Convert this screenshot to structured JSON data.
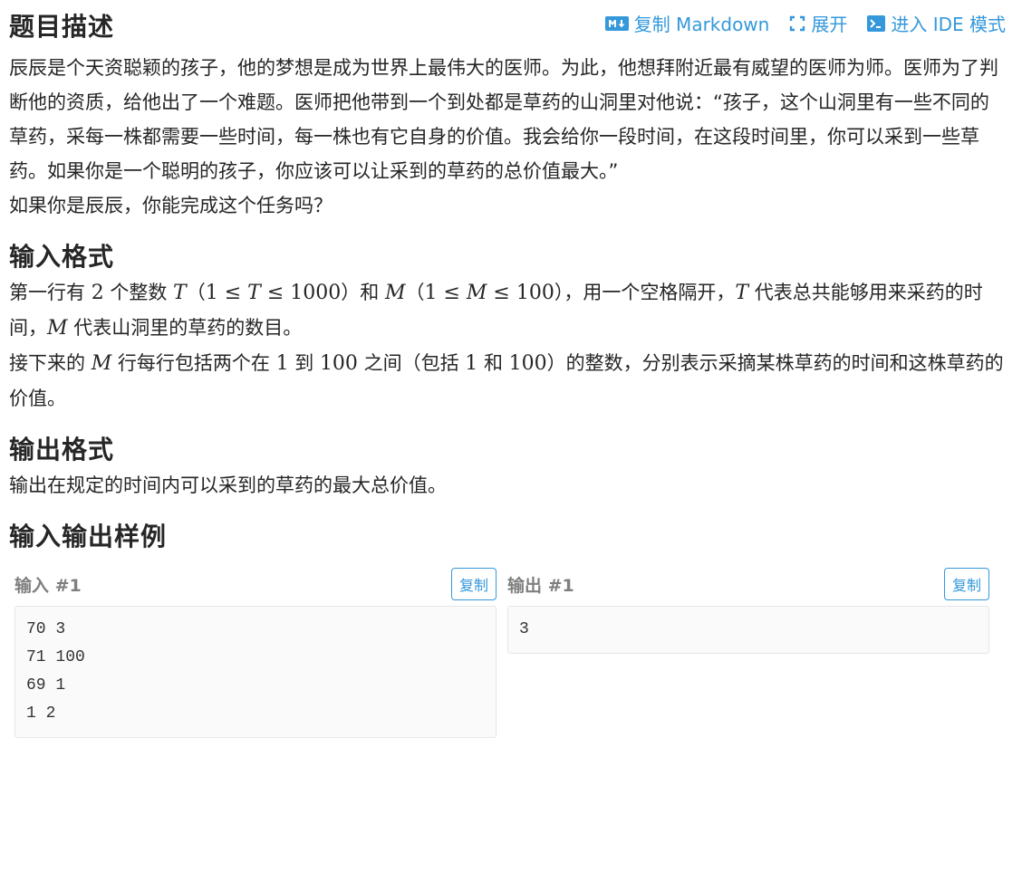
{
  "header": {
    "title": "题目描述",
    "toolbar": {
      "copy_markdown": "复制 Markdown",
      "expand": "展开",
      "ide_mode": "进入 IDE 模式"
    }
  },
  "description": {
    "paragraph1": "辰辰是个天资聪颖的孩子，他的梦想是成为世界上最伟大的医师。为此，他想拜附近最有威望的医师为师。医师为了判断他的资质，给他出了一个难题。医师把他带到一个到处都是草药的山洞里对他说：“孩子，这个山洞里有一些不同的草药，采每一株都需要一些时间，每一株也有它自身的价值。我会给你一段时间，在这段时间里，你可以采到一些草药。如果你是一个聪明的孩子，你应该可以让采到的草药的总价值最大。”",
    "paragraph2": "如果你是辰辰，你能完成这个任务吗？"
  },
  "input_format": {
    "title": "输入格式",
    "p1": {
      "t1": "第一行有 ",
      "n2": "2",
      "t2": " 个整数 ",
      "T": "T",
      "c1": "（",
      "r1": "1 ≤ ",
      "T2": "T",
      "r1b": " ≤ 1000",
      "c2": "）和 ",
      "M": "M",
      "c3": "（",
      "r2": "1 ≤ ",
      "M2": "M",
      "r2b": " ≤ 100",
      "c4": "），用一个空格隔开，",
      "T3": "T",
      "t3": " 代表总共能够用来采药的时间，",
      "M3": "M",
      "t4": " 代表山洞里的草药的数目。"
    },
    "p2": {
      "t1": "接下来的 ",
      "M": "M",
      "t2": " 行每行包括两个在 ",
      "n1": "1",
      "t3": " 到 ",
      "n2": "100",
      "t4": " 之间（包括 ",
      "n3": "1",
      "t5": " 和 ",
      "n4": "100",
      "t6": "）的整数，分别表示采摘某株草药的时间和这株草药的价值。"
    }
  },
  "output_format": {
    "title": "输出格式",
    "p1": "输出在规定的时间内可以采到的草药的最大总价值。"
  },
  "samples": {
    "title": "输入输出样例",
    "input": {
      "label": "输入 #1",
      "copy": "复制",
      "lines": [
        "70 3",
        "71 100",
        "69 1",
        "1 2"
      ]
    },
    "output": {
      "label": "输出 #1",
      "copy": "复制",
      "lines": [
        "3"
      ]
    }
  },
  "colors": {
    "accent": "#3498db",
    "text": "#262626",
    "muted": "#7f7f7f",
    "code_bg": "#fafafa"
  }
}
